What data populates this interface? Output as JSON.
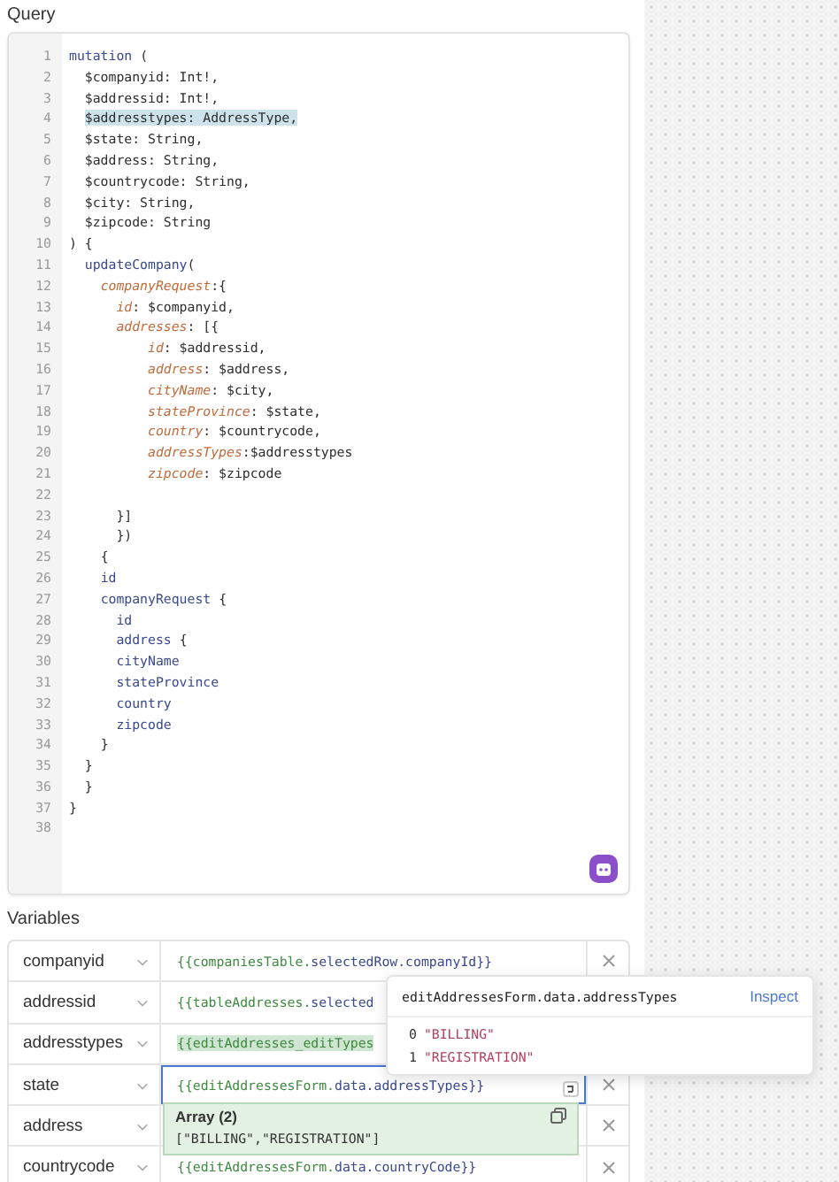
{
  "query": {
    "label": "Query",
    "lines": [
      {
        "number": "1",
        "highlighted": false,
        "tokens": [
          {
            "text": "mutation",
            "kind": "keyword"
          },
          {
            "text": " (",
            "kind": "plain"
          }
        ]
      },
      {
        "number": "2",
        "highlighted": false,
        "tokens": [
          {
            "text": "  $companyid: Int!,",
            "kind": "plain"
          }
        ]
      },
      {
        "number": "3",
        "highlighted": false,
        "tokens": [
          {
            "text": "  $addressid: Int!,",
            "kind": "plain"
          }
        ]
      },
      {
        "number": "4",
        "highlighted": true,
        "tokens": [
          {
            "text": "  $addresstypes: AddressType,",
            "kind": "plain"
          }
        ]
      },
      {
        "number": "5",
        "highlighted": false,
        "tokens": [
          {
            "text": "  $state: String,",
            "kind": "plain"
          }
        ]
      },
      {
        "number": "6",
        "highlighted": false,
        "tokens": [
          {
            "text": "  $address: String,",
            "kind": "plain"
          }
        ]
      },
      {
        "number": "7",
        "highlighted": false,
        "tokens": [
          {
            "text": "  $countrycode: String,",
            "kind": "plain"
          }
        ]
      },
      {
        "number": "8",
        "highlighted": false,
        "tokens": [
          {
            "text": "  $city: String,",
            "kind": "plain"
          }
        ]
      },
      {
        "number": "9",
        "highlighted": false,
        "tokens": [
          {
            "text": "  $zipcode: String",
            "kind": "plain"
          }
        ]
      },
      {
        "number": "10",
        "highlighted": false,
        "tokens": [
          {
            "text": ") {",
            "kind": "plain"
          }
        ]
      },
      {
        "number": "11",
        "highlighted": false,
        "tokens": [
          {
            "text": "  updateCompany",
            "kind": "keyword"
          },
          {
            "text": "(",
            "kind": "plain"
          }
        ]
      },
      {
        "number": "12",
        "highlighted": false,
        "tokens": [
          {
            "text": "    companyRequest",
            "kind": "argument"
          },
          {
            "text": ":{",
            "kind": "plain"
          }
        ]
      },
      {
        "number": "13",
        "highlighted": false,
        "tokens": [
          {
            "text": "      id",
            "kind": "argument"
          },
          {
            "text": ": $companyid,",
            "kind": "plain"
          }
        ]
      },
      {
        "number": "14",
        "highlighted": false,
        "tokens": [
          {
            "text": "      addresses",
            "kind": "argument"
          },
          {
            "text": ": [{",
            "kind": "plain"
          }
        ]
      },
      {
        "number": "15",
        "highlighted": false,
        "tokens": [
          {
            "text": "          id",
            "kind": "argument"
          },
          {
            "text": ": $addressid,",
            "kind": "plain"
          }
        ]
      },
      {
        "number": "16",
        "highlighted": false,
        "tokens": [
          {
            "text": "          address",
            "kind": "argument"
          },
          {
            "text": ": $address,",
            "kind": "plain"
          }
        ]
      },
      {
        "number": "17",
        "highlighted": false,
        "tokens": [
          {
            "text": "          cityName",
            "kind": "argument"
          },
          {
            "text": ": $city,",
            "kind": "plain"
          }
        ]
      },
      {
        "number": "18",
        "highlighted": false,
        "tokens": [
          {
            "text": "          stateProvince",
            "kind": "argument"
          },
          {
            "text": ": $state,",
            "kind": "plain"
          }
        ]
      },
      {
        "number": "19",
        "highlighted": false,
        "tokens": [
          {
            "text": "          country",
            "kind": "argument"
          },
          {
            "text": ": $countrycode,",
            "kind": "plain"
          }
        ]
      },
      {
        "number": "20",
        "highlighted": false,
        "tokens": [
          {
            "text": "          addressTypes",
            "kind": "argument"
          },
          {
            "text": ":$addresstypes",
            "kind": "plain"
          }
        ]
      },
      {
        "number": "21",
        "highlighted": false,
        "tokens": [
          {
            "text": "          zipcode",
            "kind": "argument"
          },
          {
            "text": ": $zipcode",
            "kind": "plain"
          }
        ]
      },
      {
        "number": "22",
        "highlighted": false
      },
      {
        "number": "23",
        "highlighted": false,
        "tokens": [
          {
            "text": "      }]",
            "kind": "plain"
          }
        ]
      },
      {
        "number": "24",
        "highlighted": false,
        "tokens": [
          {
            "text": "      })",
            "kind": "plain"
          }
        ]
      },
      {
        "number": "25",
        "highlighted": false,
        "tokens": [
          {
            "text": "    {",
            "kind": "plain"
          }
        ]
      },
      {
        "number": "26",
        "highlighted": false,
        "tokens": [
          {
            "text": "    id",
            "kind": "keyword"
          }
        ]
      },
      {
        "number": "27",
        "highlighted": false,
        "tokens": [
          {
            "text": "    companyRequest",
            "kind": "keyword"
          },
          {
            "text": " {",
            "kind": "plain"
          }
        ]
      },
      {
        "number": "28",
        "highlighted": false,
        "tokens": [
          {
            "text": "      id",
            "kind": "keyword"
          }
        ]
      },
      {
        "number": "29",
        "highlighted": false,
        "tokens": [
          {
            "text": "      address",
            "kind": "keyword"
          },
          {
            "text": " {",
            "kind": "plain"
          }
        ]
      },
      {
        "number": "30",
        "highlighted": false,
        "tokens": [
          {
            "text": "      cityName",
            "kind": "keyword"
          }
        ]
      },
      {
        "number": "31",
        "highlighted": false,
        "tokens": [
          {
            "text": "      stateProvince",
            "kind": "keyword"
          }
        ]
      },
      {
        "number": "32",
        "highlighted": false,
        "tokens": [
          {
            "text": "      country",
            "kind": "keyword"
          }
        ]
      },
      {
        "number": "33",
        "highlighted": false,
        "tokens": [
          {
            "text": "      zipcode",
            "kind": "keyword"
          }
        ]
      },
      {
        "number": "34",
        "highlighted": false,
        "tokens": [
          {
            "text": "    }",
            "kind": "plain"
          }
        ]
      },
      {
        "number": "35",
        "highlighted": false,
        "tokens": [
          {
            "text": "  }",
            "kind": "plain"
          }
        ]
      },
      {
        "number": "36",
        "highlighted": false,
        "tokens": [
          {
            "text": "  }",
            "kind": "plain"
          }
        ]
      },
      {
        "number": "37",
        "highlighted": false,
        "tokens": [
          {
            "text": "}",
            "kind": "plain"
          }
        ]
      },
      {
        "number": "38",
        "highlighted": false
      }
    ]
  },
  "variables": {
    "label": "Variables",
    "rows": [
      {
        "name": "companyid",
        "focused": false,
        "highlighted": false,
        "tokens": [
          {
            "text": "{{companiesTable.",
            "kind": "ref"
          },
          {
            "text": "selectedRow.companyId}}",
            "kind": "path"
          }
        ]
      },
      {
        "name": "addressid",
        "focused": false,
        "highlighted": false,
        "tokens": [
          {
            "text": "{{tableAddresses.",
            "kind": "ref"
          },
          {
            "text": "selected",
            "kind": "path"
          }
        ]
      },
      {
        "name": "addresstypes",
        "focused": false,
        "highlighted": true,
        "tokens": [
          {
            "text": "{{editAddresses_editTypes",
            "kind": "ref"
          }
        ]
      },
      {
        "name": "state",
        "focused": true,
        "highlighted": false,
        "tokens": [
          {
            "text": "{{editAddressesForm.",
            "kind": "ref"
          },
          {
            "text": "data.addressTypes}}",
            "kind": "path"
          }
        ]
      },
      {
        "name": "address",
        "focused": false
      },
      {
        "name": "countrycode",
        "focused": false,
        "highlighted": false,
        "tokens": [
          {
            "text": "{{editAddressesForm.",
            "kind": "ref"
          },
          {
            "text": "data.countryCode}}",
            "kind": "path"
          }
        ]
      }
    ]
  },
  "inspect_popover": {
    "title": "editAddressesForm.data.addressTypes",
    "link": "Inspect",
    "items": [
      {
        "index": "0",
        "value": "\"BILLING\""
      },
      {
        "index": "1",
        "value": "\"REGISTRATION\""
      }
    ]
  },
  "preview": {
    "title": "Array (2)",
    "value": "[\"BILLING\",\"REGISTRATION\"]"
  }
}
